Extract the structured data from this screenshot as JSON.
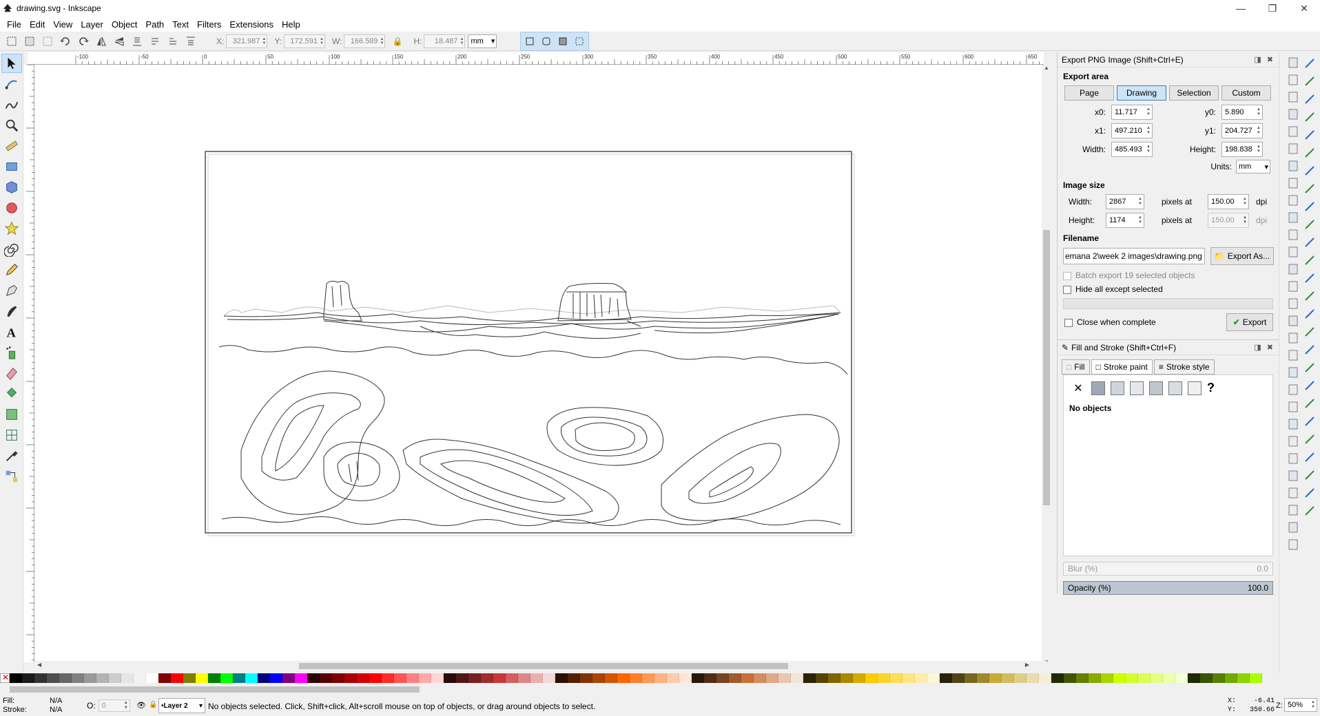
{
  "window": {
    "title": "drawing.svg - Inkscape"
  },
  "menu": [
    "File",
    "Edit",
    "View",
    "Layer",
    "Object",
    "Path",
    "Text",
    "Filters",
    "Extensions",
    "Help"
  ],
  "toolbar": {
    "x_label": "X:",
    "x_value": "321.987",
    "y_label": "Y:",
    "y_value": "172.591",
    "w_label": "W:",
    "w_value": "166.589",
    "h_label": "H:",
    "h_value": "18.487",
    "unit": "mm"
  },
  "ruler_labels": [
    "-100",
    "-50",
    "0",
    "50",
    "100",
    "150",
    "200",
    "250",
    "300",
    "350",
    "400",
    "450",
    "500",
    "550",
    "600",
    "650"
  ],
  "export": {
    "title": "Export PNG Image (Shift+Ctrl+E)",
    "area_heading": "Export area",
    "area_buttons": [
      "Page",
      "Drawing",
      "Selection",
      "Custom"
    ],
    "active_area": "Drawing",
    "x0_label": "x0:",
    "x0": "11.717",
    "y0_label": "y0:",
    "y0": "5.890",
    "x1_label": "x1:",
    "x1": "497.210",
    "y1_label": "y1:",
    "y1": "204.727",
    "width_label": "Width:",
    "width": "485.493",
    "height_label": "Height:",
    "height": "198.838",
    "units_label": "Units:",
    "units": "mm",
    "image_size_heading": "Image size",
    "img_width_label": "Width:",
    "img_width": "2867",
    "img_height_label": "Height:",
    "img_height": "1174",
    "pixels_at": "pixels at",
    "dpi1": "150.00",
    "dpi2": "150.00",
    "dpi_label": "dpi",
    "filename_heading": "Filename",
    "filename": "emana 2\\week 2 images\\drawing.png",
    "export_as": "Export As...",
    "batch_export": "Batch export 19 selected objects",
    "hide_all": "Hide all except selected",
    "close_when_complete": "Close when complete",
    "export_button": "Export"
  },
  "fill_stroke": {
    "title": "Fill and Stroke (Shift+Ctrl+F)",
    "tabs": [
      "Fill",
      "Stroke paint",
      "Stroke style"
    ],
    "no_objects": "No objects",
    "blur_label": "Blur (%)",
    "blur_value": "0.0",
    "opacity_label": "Opacity (%)",
    "opacity_value": "100.0"
  },
  "status": {
    "fill_label": "Fill:",
    "fill_value": "N/A",
    "stroke_label": "Stroke:",
    "stroke_value": "N/A",
    "o_label": "O:",
    "o_value": "0",
    "layer": "•Layer 2",
    "message": "No objects selected. Click, Shift+click, Alt+scroll mouse on top of objects, or drag around objects to select.",
    "x_coord_label": "X:",
    "x_coord": "-6.41",
    "y_coord_label": "Y:",
    "y_coord": "350.66",
    "zoom_label": "Z:",
    "zoom": "50%"
  },
  "palette": [
    "#000000",
    "#1a1a1a",
    "#333333",
    "#4d4d4d",
    "#666666",
    "#808080",
    "#999999",
    "#b3b3b3",
    "#cccccc",
    "#e6e6e6",
    "#f2f2f2",
    "#ffffff",
    "#800000",
    "#ff0000",
    "#808000",
    "#ffff00",
    "#008000",
    "#00ff00",
    "#008080",
    "#00ffff",
    "#000080",
    "#0000ff",
    "#800080",
    "#ff00ff",
    "#2b0000",
    "#550000",
    "#800000",
    "#aa0000",
    "#d40000",
    "#ff0000",
    "#ff2a2a",
    "#ff5555",
    "#ff8080",
    "#ffaaaa",
    "#ffd5d5",
    "#280b0b",
    "#501616",
    "#782121",
    "#a02c2c",
    "#c83737",
    "#d35f5f",
    "#de8787",
    "#e9afaf",
    "#f4d7d7",
    "#2b1100",
    "#552200",
    "#803300",
    "#aa4400",
    "#d45500",
    "#ff6600",
    "#ff7f2a",
    "#ff9955",
    "#ffb380",
    "#ffccaa",
    "#ffe6d5",
    "#28170b",
    "#502d16",
    "#784421",
    "#a05a2c",
    "#c87137",
    "#d38d5f",
    "#deaa87",
    "#e9c6af",
    "#f4e3d7",
    "#2b2200",
    "#554400",
    "#806600",
    "#aa8800",
    "#d4aa00",
    "#ffcc00",
    "#ffd42a",
    "#ffdd55",
    "#ffe680",
    "#ffeeaa",
    "#fff6d5",
    "#28220b",
    "#504416",
    "#786721",
    "#a0892c",
    "#c8ab37",
    "#d3bc5f",
    "#decd87",
    "#e9ddaf",
    "#f4eed7",
    "#222b00",
    "#445500",
    "#668000",
    "#88aa00",
    "#aad400",
    "#ccff00",
    "#d4ff2a",
    "#ddff55",
    "#e5ff80",
    "#eeffaa",
    "#f6ffd5",
    "#1c2b00",
    "#385500",
    "#558000",
    "#71aa00",
    "#8dd400",
    "#aaff00"
  ]
}
